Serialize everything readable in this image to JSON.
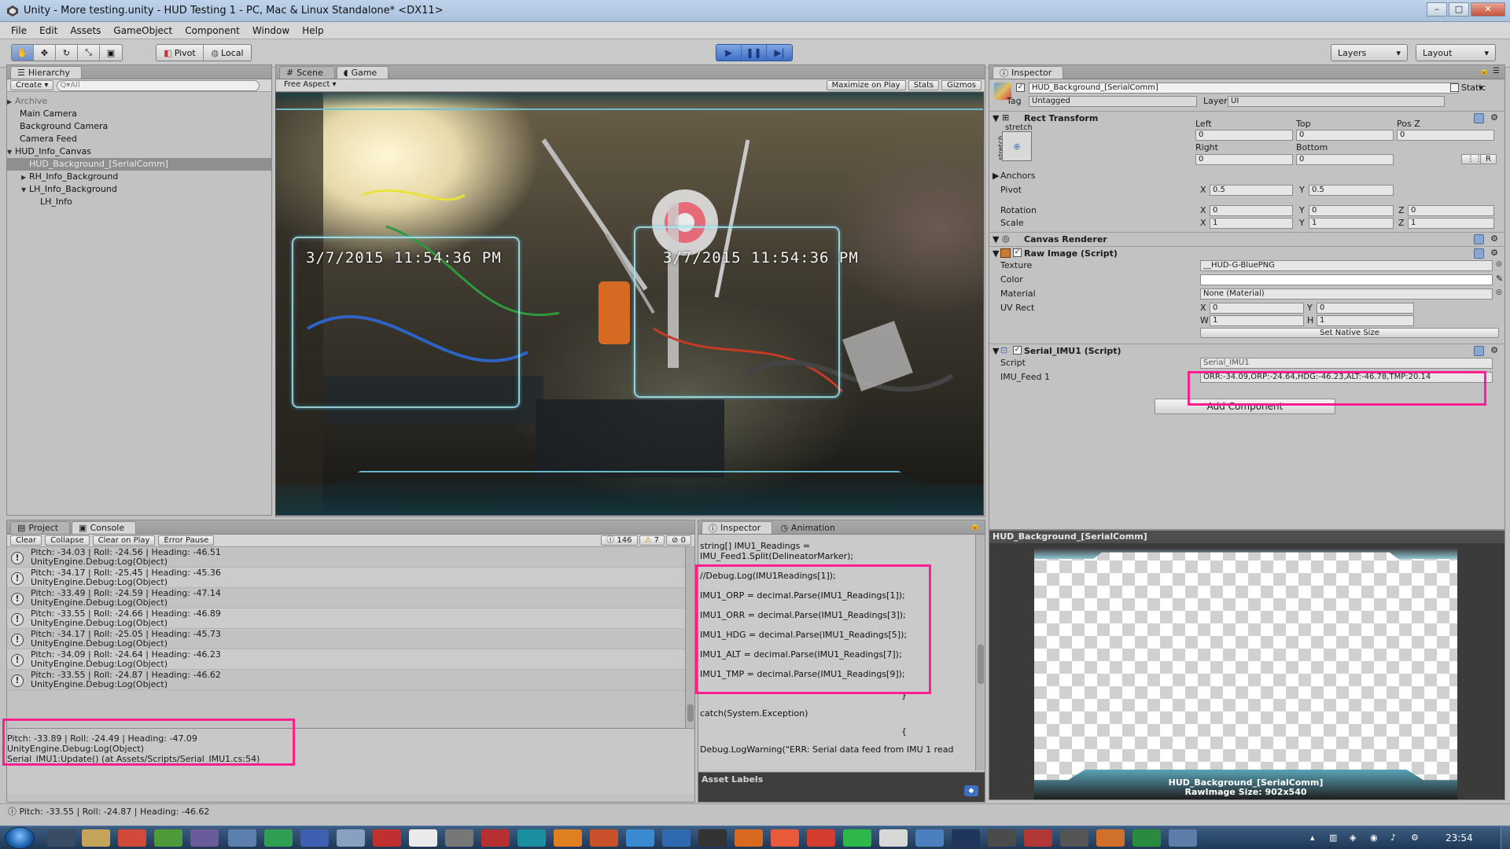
{
  "window": {
    "title": "Unity - More testing.unity - HUD Testing 1 - PC, Mac & Linux Standalone* <DX11>",
    "buttons": [
      "–",
      "□",
      "✕"
    ]
  },
  "menu": [
    "File",
    "Edit",
    "Assets",
    "GameObject",
    "Component",
    "Window",
    "Help"
  ],
  "toolbar": {
    "pivot": "Pivot",
    "local": "Local",
    "layers": "Layers",
    "layout": "Layout"
  },
  "hierarchy": {
    "tab": "Hierarchy",
    "create": "Create",
    "search_placeholder": "Q▾All",
    "items": [
      "Archive",
      "Main Camera",
      "Background Camera",
      "Camera Feed",
      "HUD_Info_Canvas",
      "HUD_Background_[SerialComm]",
      "RH_Info_Background",
      "LH_Info_Background",
      "LH_Info"
    ]
  },
  "game": {
    "tabs": [
      "Scene",
      "Game"
    ],
    "aspect": "Free Aspect",
    "maximize": "Maximize on Play",
    "stats": "Stats",
    "gizmos": "Gizmos",
    "hud_left_time": "3/7/2015  11:54:36 PM",
    "hud_right_time": "3/7/2015  11:54:36 PM"
  },
  "inspector": {
    "tab": "Inspector",
    "object_name": "HUD_Background_[SerialComm]",
    "static": "Static",
    "tag_label": "Tag",
    "tag_value": "Untagged",
    "layer_label": "Layer",
    "layer_value": "UI",
    "rect_transform": {
      "title": "Rect Transform",
      "stretch": "stretch",
      "left": "Left",
      "top": "Top",
      "posz": "Pos Z",
      "left_v": "0",
      "top_v": "0",
      "posz_v": "0",
      "right": "Right",
      "bottom": "Bottom",
      "right_v": "0",
      "bottom_v": "0",
      "anchors": "Anchors",
      "pivot": "Pivot",
      "pivot_x": "0.5",
      "pivot_y": "0.5",
      "rotation": "Rotation",
      "rot_x": "0",
      "rot_y": "0",
      "rot_z": "0",
      "scale": "Scale",
      "scale_x": "1",
      "scale_y": "1",
      "scale_z": "1",
      "r_btn": "R"
    },
    "canvas_renderer": "Canvas Renderer",
    "raw_image": {
      "title": "Raw Image (Script)",
      "texture": "Texture",
      "texture_v": "__HUD-G-BluePNG",
      "color": "Color",
      "material": "Material",
      "material_v": "None (Material)",
      "uvrect": "UV Rect",
      "x": "0",
      "y": "0",
      "w": "1",
      "h": "1",
      "set_native": "Set Native Size"
    },
    "serial": {
      "title": "Serial_IMU1 (Script)",
      "script": "Script",
      "script_v": "Serial_IMU1",
      "feed": "IMU_Feed 1",
      "feed_v": "ORR:-34.09,ORP:-24.64,HDG:-46.23,ALT:-46.78,TMP:20.14"
    },
    "add_component": "Add Component"
  },
  "preview": {
    "header": "HUD_Background_[SerialComm]",
    "name": "HUD_Background_[SerialComm]",
    "size": "RawImage Size: 902x540"
  },
  "console": {
    "tabs": [
      "Project",
      "Console"
    ],
    "buttons": [
      "Clear",
      "Collapse",
      "Clear on Play",
      "Error Pause"
    ],
    "count_info": "146",
    "count_warn": "7",
    "count_err": "0",
    "rows": [
      {
        "line1": "Pitch: -34.03 | Roll: -24.56 | Heading: -46.51",
        "line2": "UnityEngine.Debug:Log(Object)"
      },
      {
        "line1": "Pitch: -34.17 | Roll: -25.45 | Heading: -45.36",
        "line2": "UnityEngine.Debug:Log(Object)"
      },
      {
        "line1": "Pitch: -33.49 | Roll: -24.59 | Heading: -47.14",
        "line2": "UnityEngine.Debug:Log(Object)"
      },
      {
        "line1": "Pitch: -33.55 | Roll: -24.66 | Heading: -46.89",
        "line2": "UnityEngine.Debug:Log(Object)"
      },
      {
        "line1": "Pitch: -34.17 | Roll: -25.05 | Heading: -45.73",
        "line2": "UnityEngine.Debug:Log(Object)"
      },
      {
        "line1": "Pitch: -34.09 | Roll: -24.64 | Heading: -46.23",
        "line2": "UnityEngine.Debug:Log(Object)"
      },
      {
        "line1": "Pitch: -33.55 | Roll: -24.87 | Heading: -46.62",
        "line2": "UnityEngine.Debug:Log(Object)"
      }
    ],
    "detail": [
      "Pitch: -33.89 | Roll: -24.49 | Heading: -47.09",
      "UnityEngine.Debug:Log(Object)",
      "Serial_IMU1:Update() (at Assets/Scripts/Serial_IMU1.cs:54)"
    ]
  },
  "code_panel": {
    "tabs": [
      "Inspector",
      "Animation"
    ],
    "lines": [
      "string[] IMU1_Readings =",
      "IMU_Feed1.Split(DelineatorMarker);",
      "//Debug.Log(IMU1Readings[1]);",
      "IMU1_ORP = decimal.Parse(IMU1_Readings[1]);",
      "IMU1_ORR = decimal.Parse(IMU1_Readings[3]);",
      "IMU1_HDG = decimal.Parse(IMU1_Readings[5]);",
      "IMU1_ALT = decimal.Parse(IMU1_Readings[7]);",
      "IMU1_TMP = decimal.Parse(IMU1_Readings[9]);",
      "}",
      "catch(System.Exception)",
      "{",
      "Debug.LogWarning(\"ERR: Serial data feed from IMU 1 read"
    ],
    "asset_labels": "Asset Labels"
  },
  "statusbar": "Pitch: -33.55 | Roll: -24.87 | Heading: -46.62",
  "taskbar": {
    "clock": "23:54"
  }
}
